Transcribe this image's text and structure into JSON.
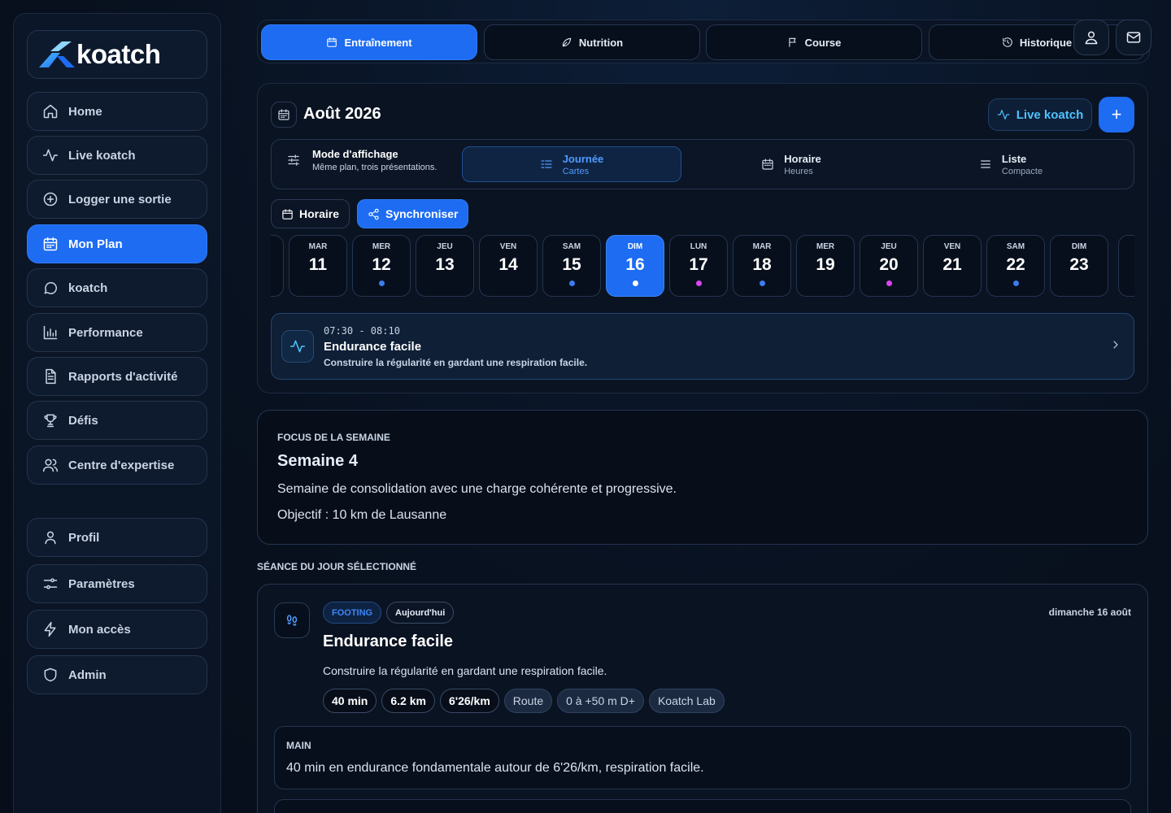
{
  "brand": {
    "name": "koatch"
  },
  "sidebar": {
    "items": [
      {
        "label": "Home",
        "icon": "home-icon"
      },
      {
        "label": "Live koatch",
        "icon": "activity-icon"
      },
      {
        "label": "Logger une sortie",
        "icon": "plus-circle-icon"
      },
      {
        "label": "Mon Plan",
        "icon": "calendar-icon",
        "active": true
      },
      {
        "label": "koatch",
        "icon": "chat-bubble-icon"
      },
      {
        "label": "Performance",
        "icon": "bar-chart-icon"
      },
      {
        "label": "Rapports d'activité",
        "icon": "document-icon"
      },
      {
        "label": "Défis",
        "icon": "trophy-icon"
      },
      {
        "label": "Centre d'expertise",
        "icon": "users-icon"
      }
    ],
    "bottom_items": [
      {
        "label": "Profil",
        "icon": "user-icon"
      },
      {
        "label": "Paramètres",
        "icon": "sliders-icon"
      },
      {
        "label": "Mon accès",
        "icon": "bolt-icon"
      },
      {
        "label": "Admin",
        "icon": "shield-icon"
      }
    ]
  },
  "tabs": [
    {
      "label": "Entraînement",
      "icon": "calendar-icon",
      "active": true
    },
    {
      "label": "Nutrition",
      "icon": "leaf-icon"
    },
    {
      "label": "Course",
      "icon": "flag-icon"
    },
    {
      "label": "Historique",
      "icon": "history-icon"
    }
  ],
  "header_icons": [
    "profile-pin-icon",
    "mail-icon"
  ],
  "calendar": {
    "month": "Août 2026",
    "live_label": "Live koatch",
    "add_label": "+",
    "mode": {
      "title": "Mode d'affichage",
      "subtitle": "Même plan, trois présentations.",
      "options": [
        {
          "label": "Journée",
          "sub": "Cartes",
          "active": true
        },
        {
          "label": "Horaire",
          "sub": "Heures"
        },
        {
          "label": "Liste",
          "sub": "Compacte"
        }
      ]
    },
    "horaire_label": "Horaire",
    "sync_label": "Synchroniser",
    "days": [
      {
        "name": "MAR",
        "num": "11",
        "dot": ""
      },
      {
        "name": "MER",
        "num": "12",
        "dot": "#3d7cf0"
      },
      {
        "name": "JEU",
        "num": "13",
        "dot": ""
      },
      {
        "name": "VEN",
        "num": "14",
        "dot": ""
      },
      {
        "name": "SAM",
        "num": "15",
        "dot": "#3d7cf0"
      },
      {
        "name": "DIM",
        "num": "16",
        "dot": "#ffffff",
        "selected": true
      },
      {
        "name": "LUN",
        "num": "17",
        "dot": "#d946ef"
      },
      {
        "name": "MAR",
        "num": "18",
        "dot": "#3d7cf0"
      },
      {
        "name": "MER",
        "num": "19",
        "dot": ""
      },
      {
        "name": "JEU",
        "num": "20",
        "dot": "#d946ef"
      },
      {
        "name": "VEN",
        "num": "21",
        "dot": ""
      },
      {
        "name": "SAM",
        "num": "22",
        "dot": "#3d7cf0"
      },
      {
        "name": "DIM",
        "num": "23",
        "dot": ""
      }
    ],
    "session": {
      "time": "07:30 - 08:10",
      "title": "Endurance facile",
      "desc": "Construire la régularité en gardant une respiration facile."
    }
  },
  "focus": {
    "kicker": "FOCUS DE LA SEMAINE",
    "title": "Semaine 4",
    "desc": "Semaine de consolidation avec une charge cohérente et progressive.",
    "objective": "Objectif : 10 km de Lausanne"
  },
  "selected_section_label": "SÉANCE DU JOUR SÉLECTIONNÉ",
  "detail": {
    "badge_type": "FOOTING",
    "badge_today": "Aujourd'hui",
    "date": "dimanche 16 août",
    "title": "Endurance facile",
    "desc": "Construire la régularité en gardant une respiration facile.",
    "pills": [
      {
        "label": "40 min",
        "style": "strong"
      },
      {
        "label": "6.2 km",
        "style": "strong"
      },
      {
        "label": "6'26/km",
        "style": "strong"
      },
      {
        "label": "Route",
        "style": "soft"
      },
      {
        "label": "0 à +50 m D+",
        "style": "soft"
      },
      {
        "label": "Koatch Lab",
        "style": "soft"
      }
    ],
    "main_label": "MAIN",
    "main_text": "40 min en endurance fondamentale autour de 6'26/km, respiration facile."
  },
  "colors": {
    "accent": "#1d6cf2",
    "cyan": "#4fc2ff",
    "background": "#08111f",
    "dot_blue": "#3d7cf0",
    "dot_magenta": "#d946ef"
  }
}
